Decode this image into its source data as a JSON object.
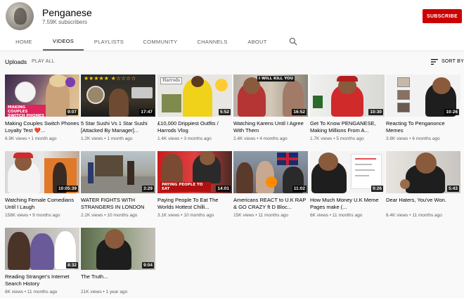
{
  "channel": {
    "name": "Penganese",
    "subscribers": "7.59K subscribers",
    "subscribe_label": "SUBSCRIBE"
  },
  "tabs": [
    {
      "label": "HOME"
    },
    {
      "label": "VIDEOS"
    },
    {
      "label": "PLAYLISTS"
    },
    {
      "label": "COMMUNITY"
    },
    {
      "label": "CHANNELS"
    },
    {
      "label": "ABOUT"
    }
  ],
  "uploads": {
    "title": "Uploads",
    "play_all": "PLAY ALL",
    "sort_by": "SORT BY"
  },
  "icons": {
    "search": "search-icon",
    "sort": "sort-icon"
  },
  "colors": {
    "subscribe": "#cc0000",
    "page_bg": "#f9f9f9"
  },
  "videos": [
    {
      "title": "Making Couples Switch Phones Loyalty Test ❤️...",
      "views": "6.9K views",
      "age": "1 month ago",
      "duration": "9:07",
      "thumb_text": "MAKING COUPLES SWITCH PHONES"
    },
    {
      "title": "5 Star Sushi Vs 1 Star Sushi [Attacked By Manager]...",
      "views": "1.2K views",
      "age": "1 month ago",
      "duration": "17:47",
      "thumb_text": "★★★★★ ★☆☆☆☆"
    },
    {
      "title": "£10,000 Drippiest Outfits / Harrods Vlog",
      "views": "1.4K views",
      "age": "3 months ago",
      "duration": "5:52",
      "thumb_text": "Harrods"
    },
    {
      "title": "Watching Karens Until I Agree With Them",
      "views": "2.4K views",
      "age": "4 months ago",
      "duration": "16:52",
      "thumb_text": "I WILL KILL YOU"
    },
    {
      "title": "Get To Know PENGANESE, Making Millions From A...",
      "views": "1.7K views",
      "age": "5 months ago",
      "duration": "10:30",
      "thumb_text": ""
    },
    {
      "title": "Reacting To Penganonce Memes",
      "views": "3.8K views",
      "age": "6 months ago",
      "duration": "10:26",
      "thumb_text": ""
    },
    {
      "title": "Watching Female Comedians Until I Laugh",
      "views": "158K views",
      "age": "9 months ago",
      "duration": "10:05:39",
      "thumb_text": ""
    },
    {
      "title": "WATER FIGHTS WITH STRANGERS IN LONDON",
      "views": "2.2K views",
      "age": "10 months ago",
      "duration": "3:29",
      "thumb_text": ""
    },
    {
      "title": "Paying People To Eat The Worlds Hottest Chilli...",
      "views": "3.1K views",
      "age": "10 months ago",
      "duration": "14:01",
      "thumb_text": "PAYING PEOPLE TO EAT"
    },
    {
      "title": "Americans REACT to U.K RAP & GO CRAZY ft D Bloc...",
      "views": "15K views",
      "age": "11 months ago",
      "duration": "11:02",
      "thumb_text": ""
    },
    {
      "title": "How Much Money U.K Meme Pages make (...",
      "views": "6K views",
      "age": "11 months ago",
      "duration": "9:26",
      "thumb_text": ""
    },
    {
      "title": "Dear Haters, You've Won.",
      "views": "6.4K views",
      "age": "11 months ago",
      "duration": "5:43",
      "thumb_text": ""
    },
    {
      "title": "Reading Stranger's Internet Search History",
      "views": "8K views",
      "age": "11 months ago",
      "duration": "8:32",
      "thumb_text": ""
    },
    {
      "title": "The Truth...",
      "views": "21K views",
      "age": "1 year ago",
      "duration": "9:04",
      "thumb_text": ""
    }
  ]
}
